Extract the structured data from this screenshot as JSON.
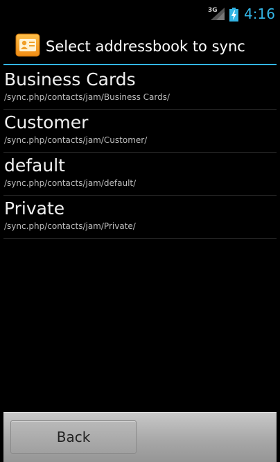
{
  "status_bar": {
    "network_type": "3G",
    "time": "4:16",
    "signal_icon": "signal-icon",
    "battery_icon": "battery-charging-icon",
    "accent_color": "#33b5e5"
  },
  "header": {
    "icon": "addressbook-icon",
    "title": "Select addressbook to sync",
    "divider_color": "#33b5e5"
  },
  "addressbooks": [
    {
      "name": "Business Cards",
      "path": "/sync.php/contacts/jam/Business Cards/"
    },
    {
      "name": "Customer",
      "path": "/sync.php/contacts/jam/Customer/"
    },
    {
      "name": "default",
      "path": "/sync.php/contacts/jam/default/"
    },
    {
      "name": "Private",
      "path": "/sync.php/contacts/jam/Private/"
    }
  ],
  "footer": {
    "back_label": "Back"
  }
}
